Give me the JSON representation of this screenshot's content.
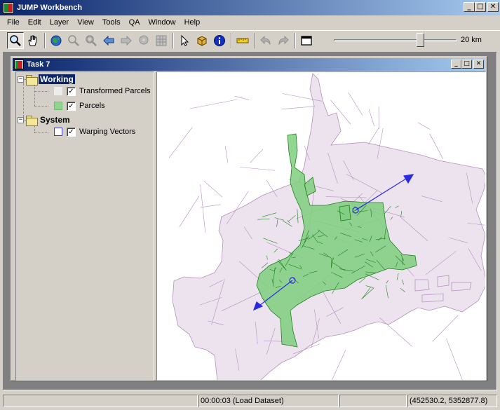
{
  "app": {
    "title": "JUMP Workbench"
  },
  "window_controls": {
    "minimize": "_",
    "maximize": "□",
    "close": "✕"
  },
  "menu": [
    "File",
    "Edit",
    "Layer",
    "View",
    "Tools",
    "QA",
    "Window",
    "Help"
  ],
  "toolbar": {
    "tools": [
      {
        "name": "zoom-tool",
        "icon": "magnifier-icon",
        "pressed": true
      },
      {
        "name": "pan-tool",
        "icon": "hand-icon"
      },
      {
        "name": "zoom-to-full-extent",
        "icon": "globe-icon"
      },
      {
        "name": "zoom-to-selected",
        "icon": "zoom-selected-icon"
      },
      {
        "name": "zoom-to-fence",
        "icon": "zoom-fence-icon"
      },
      {
        "name": "zoom-previous",
        "icon": "arrow-left-icon"
      },
      {
        "name": "zoom-next",
        "icon": "arrow-right-icon"
      },
      {
        "name": "zoom-to-point",
        "icon": "pin-icon"
      },
      {
        "name": "grid",
        "icon": "grid-icon"
      },
      {
        "name": "select-tool",
        "icon": "cursor-icon"
      },
      {
        "name": "feature-info",
        "icon": "box-icon"
      },
      {
        "name": "info",
        "icon": "info-icon"
      },
      {
        "name": "measure",
        "icon": "ruler-icon"
      },
      {
        "name": "undo",
        "icon": "undo-icon"
      },
      {
        "name": "redo",
        "icon": "redo-icon"
      },
      {
        "name": "new-window",
        "icon": "window-icon"
      }
    ],
    "scale_label": "20 km",
    "scale_slider_fraction": 0.72
  },
  "task_window": {
    "title": "Task 7"
  },
  "layer_tree": {
    "categories": [
      {
        "label": "Working",
        "selected": true,
        "layers": [
          {
            "label": "Transformed Parcels",
            "checked": true,
            "swatch_fill": "#ececec",
            "swatch_border": "#ececec"
          },
          {
            "label": "Parcels",
            "checked": true,
            "swatch_fill": "#8fd48f",
            "swatch_border": "#6cbf6c"
          }
        ]
      },
      {
        "label": "System",
        "selected": false,
        "layers": [
          {
            "label": "Warping Vectors",
            "checked": true,
            "swatch_fill": "#ffffff",
            "swatch_border": "#3a3ad8"
          }
        ]
      }
    ],
    "check_glyph": "✓",
    "expander_glyph": "−"
  },
  "colors": {
    "title_gradient_start": "#0a246a",
    "title_gradient_end": "#a6caf0",
    "transformed_parcel_fill": "#ece3ee",
    "transformed_parcel_stroke": "#b78fc0",
    "parcel_fill": "#7fcf7f",
    "parcel_stroke": "#1f7f1f",
    "vector_color": "#2a2ae0"
  },
  "status": {
    "message": "",
    "time": "00:00:03 (Load Dataset)",
    "extra": "",
    "coordinates": "(452530.2, 5352877.8)"
  }
}
